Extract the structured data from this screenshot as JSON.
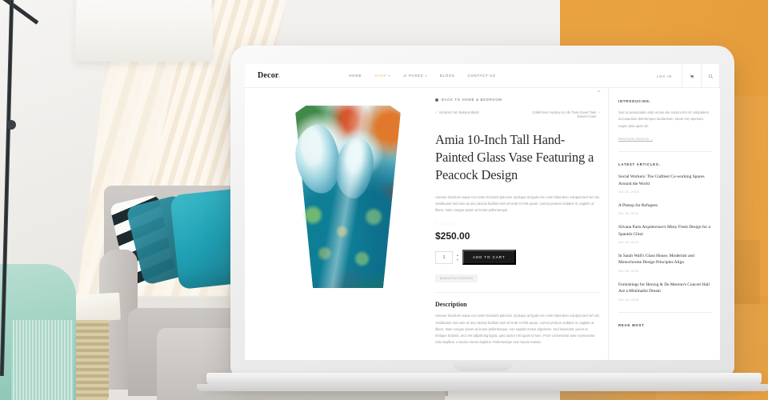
{
  "site": {
    "logo": "Decor",
    "logo_dot": ".",
    "nav": [
      {
        "label": "HOME",
        "caret": "",
        "active": false
      },
      {
        "label": "SHOP",
        "caret": "▾",
        "active": true
      },
      {
        "label": "JI PAGES",
        "caret": "▾",
        "active": false
      },
      {
        "label": "BLOGS",
        "caret": "",
        "active": false
      },
      {
        "label": "CONTACT US",
        "caret": "",
        "active": false
      }
    ],
    "login": "LOG IN",
    "cart_icon": "cart-icon",
    "search_icon": "search-icon"
  },
  "breadcrumb": {
    "label": "BACK TO  HOME & BEDROOM",
    "prev_arrow": "‹",
    "prev": "Vondom Faz Butaca Black",
    "next": "CafePress Hockey is Life Twin Duvet Twin Duvet Cover",
    "next_arrow": "›"
  },
  "product": {
    "title": "Amia 10-Inch Tall Hand-Painted Glass Vase Featuring a Peacock Design",
    "share_icon": "share-icon",
    "excerpt": "Aenean tincidunt neque nec tortor tincidunt placerat. Quisque at ligula nec enim bibendum volutpat sed vel nisi. Vestibulum sed ante at arcu lacinia facilisis sed vel erat! In felis quam, cursus pretium sodales in, sagittis ut libero. Nam congue ipsum at lectus pellentesque.",
    "stars": "☆☆☆☆☆",
    "price": "$250.00",
    "qty": "1",
    "qty_up": "▴",
    "qty_down": "▾",
    "add_to_cart": "ADD TO CART",
    "tag": "MANUFACTURERS",
    "image_alt": "peacock-glass-vase"
  },
  "description": {
    "heading": "Description",
    "body": "Aenean tincidunt neque nec tortor tincidunt placerat. Quisque at ligula nec enim bibendum volutpat sed vel nisi. Vestibulum sed ante at arcu lacinia facilisis sed vel erat! In felis quam, cursus pretium sodales in, sagittis ut libero. Nam congue ipsum at lectus pellentesque, non sagittis metus dignissim. Sed imperdiet, purus et tristique facilisis, arcu est adipiscing ligula, quis auctor nisl quam id sem. Proin consectetur ante consectetur odio dapibus, a lacinia metus dapibus. Pellentesque sed mauris massa."
  },
  "sidebar": {
    "intro_heading": "INTRODUCING.",
    "intro_text": "Sed ut perspiciatis unde omnis iste natus error sit voluptatem accusantium doloremque laudantium, totam rem aperiam, eaque ipsa quae ab.",
    "intro_link": "Read more About Us →",
    "articles_heading": "LATEST ARTICLES.",
    "articles": [
      {
        "title": "Social Workers: The Craftiest Co-working Spaces Around the World",
        "date": "Oct 28, 2018"
      },
      {
        "title": "A Pitstop for Refugees",
        "date": "Oct 28, 2018"
      },
      {
        "title": "Silvana Paris Arquitecture's Misty Fresh Design for a Spanish Clinic",
        "date": "Oct 28, 2018"
      },
      {
        "title": "In Sarah Wall's Glass House, Modernist and Monochrome Design Principles Align",
        "date": "Oct 28, 2018"
      },
      {
        "title": "Furnishings for Herzog & De Meuron's Concert Hall Are a Minimalist Dream",
        "date": "Oct 28, 2018"
      }
    ],
    "read_most": "READ MOST"
  },
  "colors": {
    "accent": "#f3ba45",
    "button": "#1b1b1b",
    "text": "#4a4a4a",
    "muted": "#9a9a9a",
    "background_warm": "#e9a23f"
  }
}
